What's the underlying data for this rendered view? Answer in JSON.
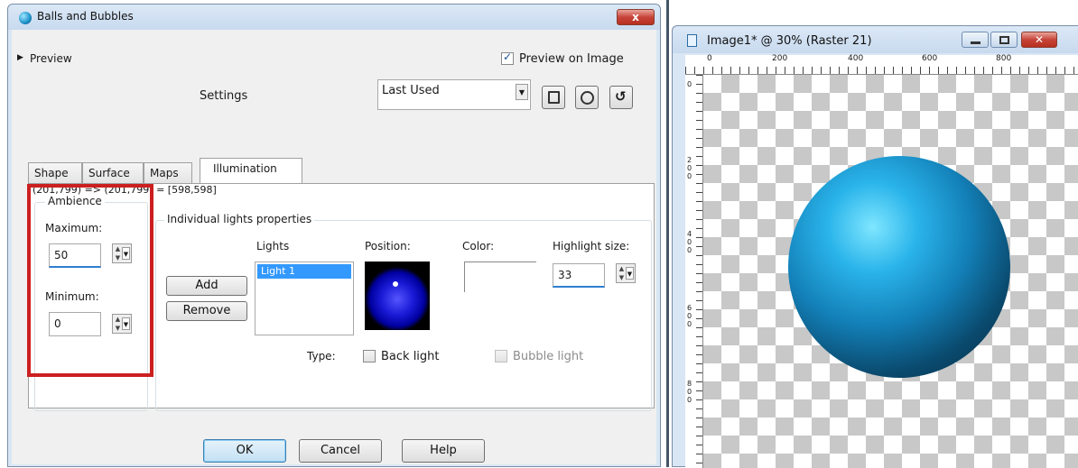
{
  "dialog": {
    "title": "Balls and Bubbles",
    "close_label": "x",
    "preview_toggle": "Preview",
    "preview_on_image_label": "Preview on Image",
    "preview_on_image_checked": true,
    "settings_label": "Settings",
    "settings_value": "Last Used",
    "tabs": [
      {
        "label": "Shape"
      },
      {
        "label": "Surface"
      },
      {
        "label": "Maps"
      },
      {
        "label": "Illumination"
      }
    ],
    "coords_text": "(201,799) => (201,799) = [598,598]",
    "ambience": {
      "title": "Ambience",
      "maximum_label": "Maximum:",
      "maximum_value": "50",
      "minimum_label": "Minimum:",
      "minimum_value": "0"
    },
    "lights": {
      "title": "Individual lights properties",
      "lights_label": "Lights",
      "items": [
        "Light 1"
      ],
      "position_label": "Position:",
      "color_label": "Color:",
      "highlight_label": "Highlight size:",
      "highlight_value": "33",
      "add_label": "Add",
      "remove_label": "Remove",
      "type_label": "Type:",
      "back_light_label": "Back light",
      "bubble_light_label": "Bubble light"
    },
    "ok_label": "OK",
    "cancel_label": "Cancel",
    "help_label": "Help"
  },
  "image_window": {
    "title": "Image1* @  30% (Raster 21)",
    "ruler_labels": [
      "0",
      "200",
      "400",
      "600",
      "800"
    ],
    "ruler_v_labels": [
      "0",
      "2\n0\n0",
      "4\n0\n0",
      "6\n0\n0",
      "8\n0\n0"
    ],
    "ball_color": "#1a9fd8"
  },
  "colors": {
    "highlight_box": "#cc1f1f",
    "selection": "#3399ff"
  }
}
